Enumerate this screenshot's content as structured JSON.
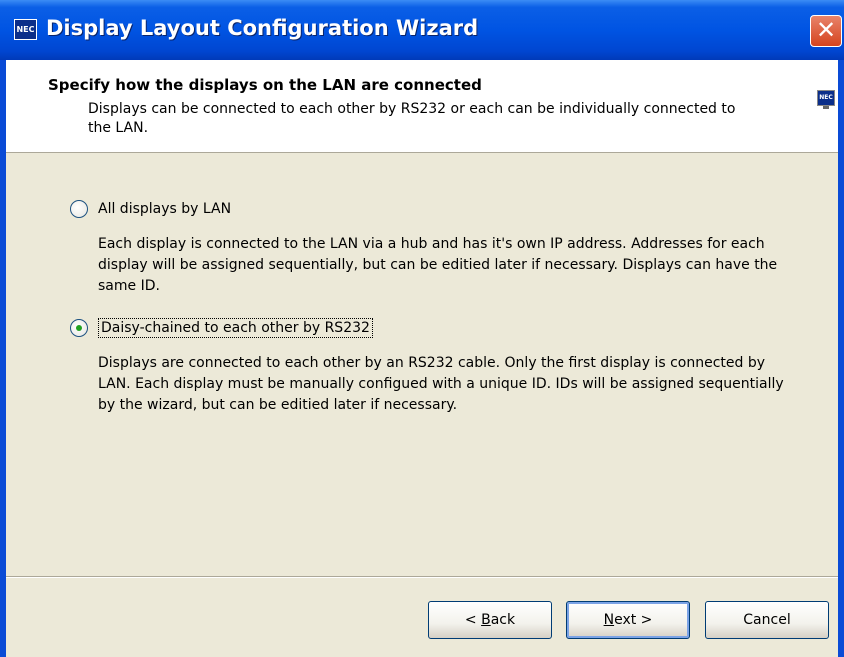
{
  "window": {
    "title": "Display Layout Configuration Wizard",
    "app_icon_text": "NEC",
    "close_glyph": "✕"
  },
  "header": {
    "title": "Specify how the displays on the LAN are connected",
    "subtitle": "Displays can be connected to each other by RS232 or each can be individually connected to the LAN.",
    "icon_text": "NEC"
  },
  "options": [
    {
      "label": "All displays by LAN",
      "selected": false,
      "description": "Each display is connected  to the LAN via a hub and has it's own IP address. Addresses for each display will be assigned sequentially, but can be editied later if necessary. Displays can have the same ID."
    },
    {
      "label": "Daisy-chained to each other by RS232",
      "selected": true,
      "description": "Displays are connected to each other by an RS232 cable. Only the first display is connected by LAN. Each display must be manually configued with a unique ID. IDs will be assigned sequentially by the wizard, but can be editied later if necessary."
    }
  ],
  "buttons": {
    "back": {
      "prefix": "< ",
      "accel": "B",
      "rest": "ack"
    },
    "next": {
      "prefix": "",
      "accel": "N",
      "rest": "ext >"
    },
    "cancel": {
      "label": "Cancel"
    }
  }
}
